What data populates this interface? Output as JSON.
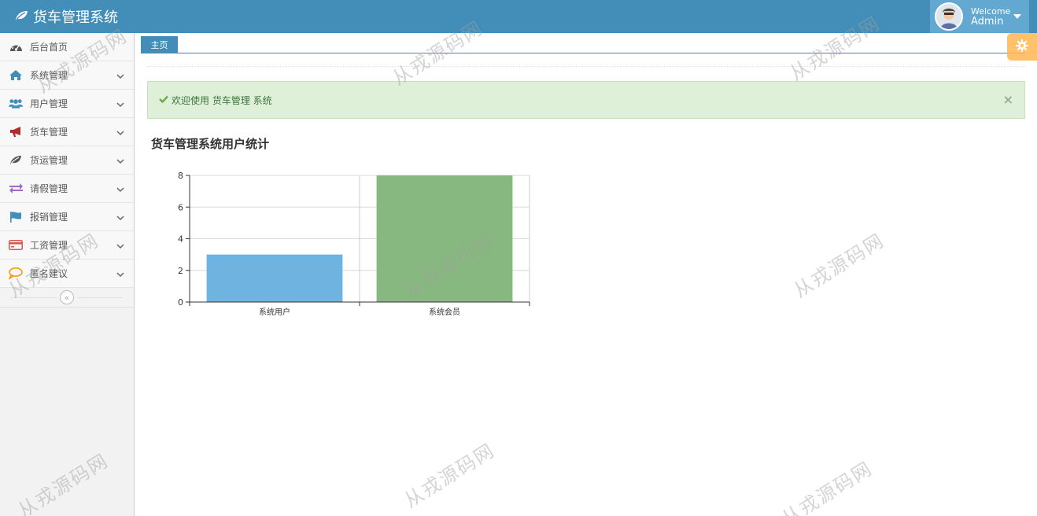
{
  "app": {
    "title": "货车管理系统"
  },
  "user": {
    "welcome": "Welcome",
    "name": "Admin"
  },
  "sidebar": {
    "items": [
      {
        "label": "后台首页",
        "icon": "dashboard-icon"
      },
      {
        "label": "系统管理",
        "icon": "home-icon"
      },
      {
        "label": "用户管理",
        "icon": "users-icon"
      },
      {
        "label": "货车管理",
        "icon": "bullhorn-icon"
      },
      {
        "label": "货运管理",
        "icon": "leaf-icon"
      },
      {
        "label": "请假管理",
        "icon": "exchange-icon"
      },
      {
        "label": "报销管理",
        "icon": "flag-icon"
      },
      {
        "label": "工资管理",
        "icon": "credit-card-icon"
      },
      {
        "label": "匿名建议",
        "icon": "comment-icon"
      }
    ],
    "collapse_glyph": "«"
  },
  "tabs": [
    {
      "label": "主页"
    }
  ],
  "alert": {
    "text": "欢迎使用 货车管理 系统",
    "close": "×"
  },
  "chart_title": "货车管理系统用户统计",
  "chart_data": {
    "type": "bar",
    "title": "货车管理系统用户统计",
    "categories": [
      "系统用户",
      "系统会员"
    ],
    "values": [
      3,
      8
    ],
    "colors": [
      "#6fb3e0",
      "#87b87f"
    ],
    "ylim": [
      0,
      8
    ],
    "yticks": [
      0,
      2,
      4,
      6,
      8
    ],
    "grid": true,
    "xlabel": "",
    "ylabel": ""
  },
  "watermark": "从戎源码网",
  "colors": {
    "navbar": "#438eb9",
    "user_box": "#62a8d1",
    "alert_bg": "#dff0d8",
    "alert_text": "#3c763d",
    "settings": "#ffb752"
  }
}
